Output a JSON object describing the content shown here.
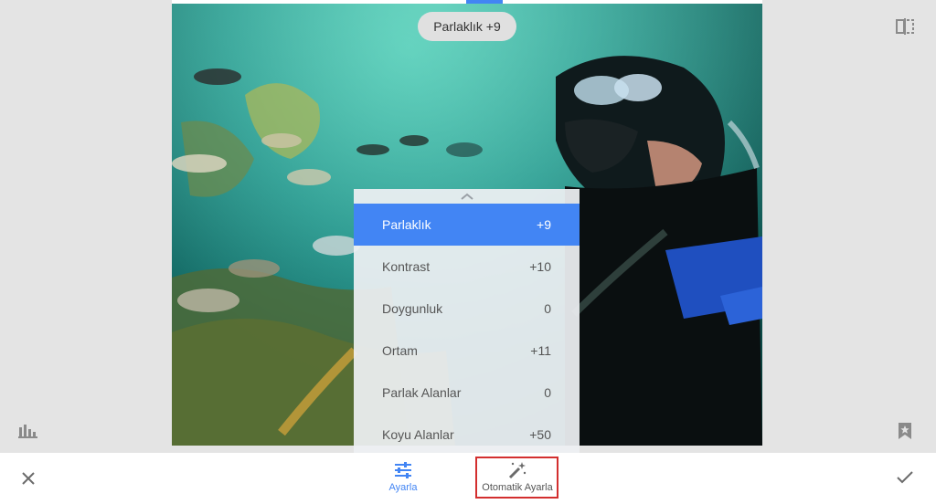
{
  "overlay": {
    "value_pill": "Parlaklık +9"
  },
  "adjustments": [
    {
      "label": "Parlaklık",
      "value": "+9",
      "active": true
    },
    {
      "label": "Kontrast",
      "value": "+10",
      "active": false
    },
    {
      "label": "Doygunluk",
      "value": "0",
      "active": false
    },
    {
      "label": "Ortam",
      "value": "+11",
      "active": false
    },
    {
      "label": "Parlak Alanlar",
      "value": "0",
      "active": false
    },
    {
      "label": "Koyu Alanlar",
      "value": "+50",
      "active": false
    }
  ],
  "toolbar": {
    "adjust_label": "Ayarla",
    "auto_label": "Otomatik Ayarla"
  },
  "icons": {
    "compare": "compare-icon",
    "histogram": "histogram-icon",
    "bookmark": "bookmark-star-icon",
    "close": "close-icon",
    "apply": "checkmark-icon",
    "adjust": "sliders-icon",
    "auto": "magic-wand-icon",
    "expand": "chevron-up-icon"
  },
  "colors": {
    "accent": "#4285f4",
    "highlight_border": "#d32f2f"
  }
}
